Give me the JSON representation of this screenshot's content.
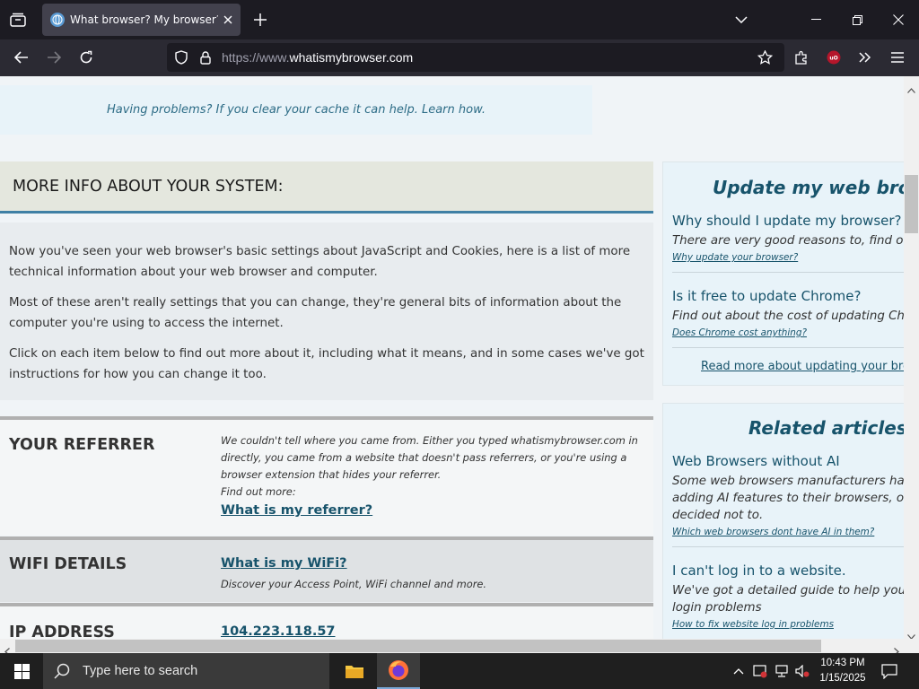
{
  "browser": {
    "tab_title": "What browser? My browser? Is c",
    "url_prefix": "https://www.",
    "url_domain": "whatismybrowser.com"
  },
  "notice": {
    "link": "Having problems? If you clear your cache it can help. Learn how."
  },
  "more_info": {
    "heading": "MORE INFO ABOUT YOUR SYSTEM:",
    "paragraphs": [
      "Now you've seen your web browser's basic settings about JavaScript and Cookies, here is a list of more technical information about your web browser and computer.",
      "Most of these aren't really settings that you can change, they're general bits of information about the computer you're using to access the internet.",
      "Click on each item below to find out more about it, including what it means, and in some cases we've got instructions for how you can change it too."
    ]
  },
  "sections": {
    "referrer": {
      "title": "YOUR REFERRER",
      "desc": "We couldn't tell where you came from. Either you typed whatismybrowser.com in directly, you came from a website that doesn't pass referrers, or you're using a browser extension that hides your referrer.",
      "findout": "Find out more:",
      "link": "What is my referrer?"
    },
    "wifi": {
      "title": "WIFI DETAILS",
      "link": "What is my WiFi?",
      "desc": "Discover your Access Point, WiFi channel and more."
    },
    "ip": {
      "title": "IP ADDRESS",
      "value": "104.223.118.57"
    }
  },
  "update_card": {
    "title": "Update my web browser",
    "items": [
      {
        "q": "Why should I update my browser?",
        "a": "There are very good reasons to, find out",
        "link": "Why update your browser?"
      },
      {
        "q": "Is it free to update Chrome?",
        "a": "Find out about the cost of updating Chrome",
        "link": "Does Chrome cost anything?"
      }
    ],
    "read_more": "Read more about updating your browser"
  },
  "related_card": {
    "title": "Related articles",
    "items": [
      {
        "q": "Web Browsers without AI",
        "a1": "Some web browsers manufacturers have been",
        "a2": "adding AI features to their browsers, others have",
        "a3": "decided not to.",
        "link": "Which web browsers dont have AI in them?"
      },
      {
        "q": "I can't log in to a website.",
        "a1": "We've got a detailed guide to help you solve",
        "a2": "login problems",
        "link": "How to fix website log in problems"
      }
    ]
  },
  "taskbar": {
    "search_placeholder": "Type here to search",
    "time": "10:43 PM",
    "date": "1/15/2025"
  }
}
